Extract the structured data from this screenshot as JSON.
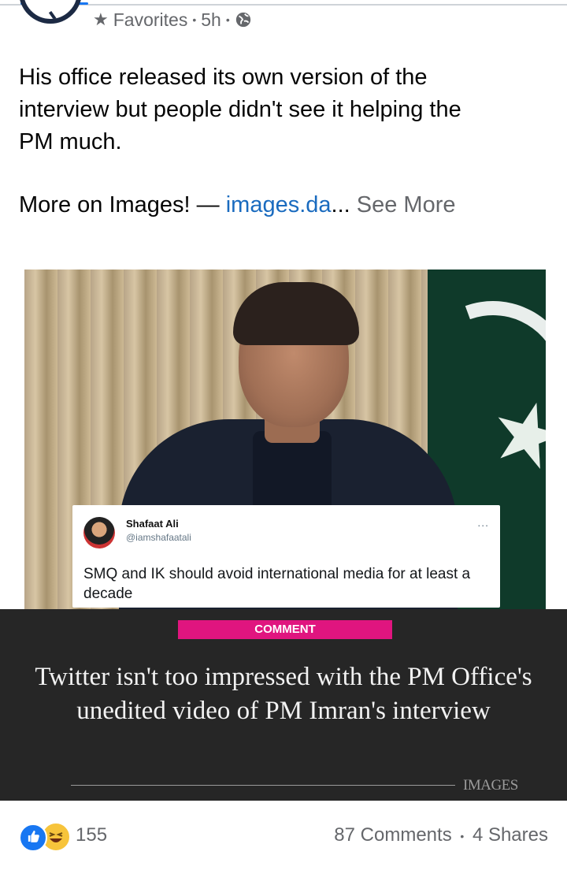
{
  "header": {
    "audience_icon": "star-icon",
    "audience_label": "Favorites",
    "time_ago": "5h",
    "privacy_icon": "globe-icon",
    "separator": "•"
  },
  "post": {
    "text_lines": [
      "His office released its own version of the",
      "interview but people didn't see it helping the",
      "PM much."
    ],
    "more_prefix": "More on Images! —",
    "more_link": "images.da",
    "ellipsis": "...",
    "see_more": "See More"
  },
  "link_preview": {
    "tweet": {
      "name": "Shafaat Ali",
      "handle": "@iamshafaatali",
      "more": "...",
      "body": "SMQ and IK should avoid international media for at least a decade"
    },
    "badge": "COMMENT",
    "headline": "Twitter isn't too impressed with the PM Office's unedited video of PM Imran's interview",
    "source_logo": "IMAGES",
    "colors": {
      "badge": "#e0157f",
      "panel": "#262626"
    }
  },
  "footer": {
    "reactions": [
      "like-icon",
      "haha-icon"
    ],
    "reaction_count": "155",
    "comments": "87 Comments",
    "shares": "4 Shares",
    "separator": "•"
  },
  "colors": {
    "link": "#1a6bbf",
    "secondary_text": "#65676b",
    "accent": "#1877f2"
  }
}
